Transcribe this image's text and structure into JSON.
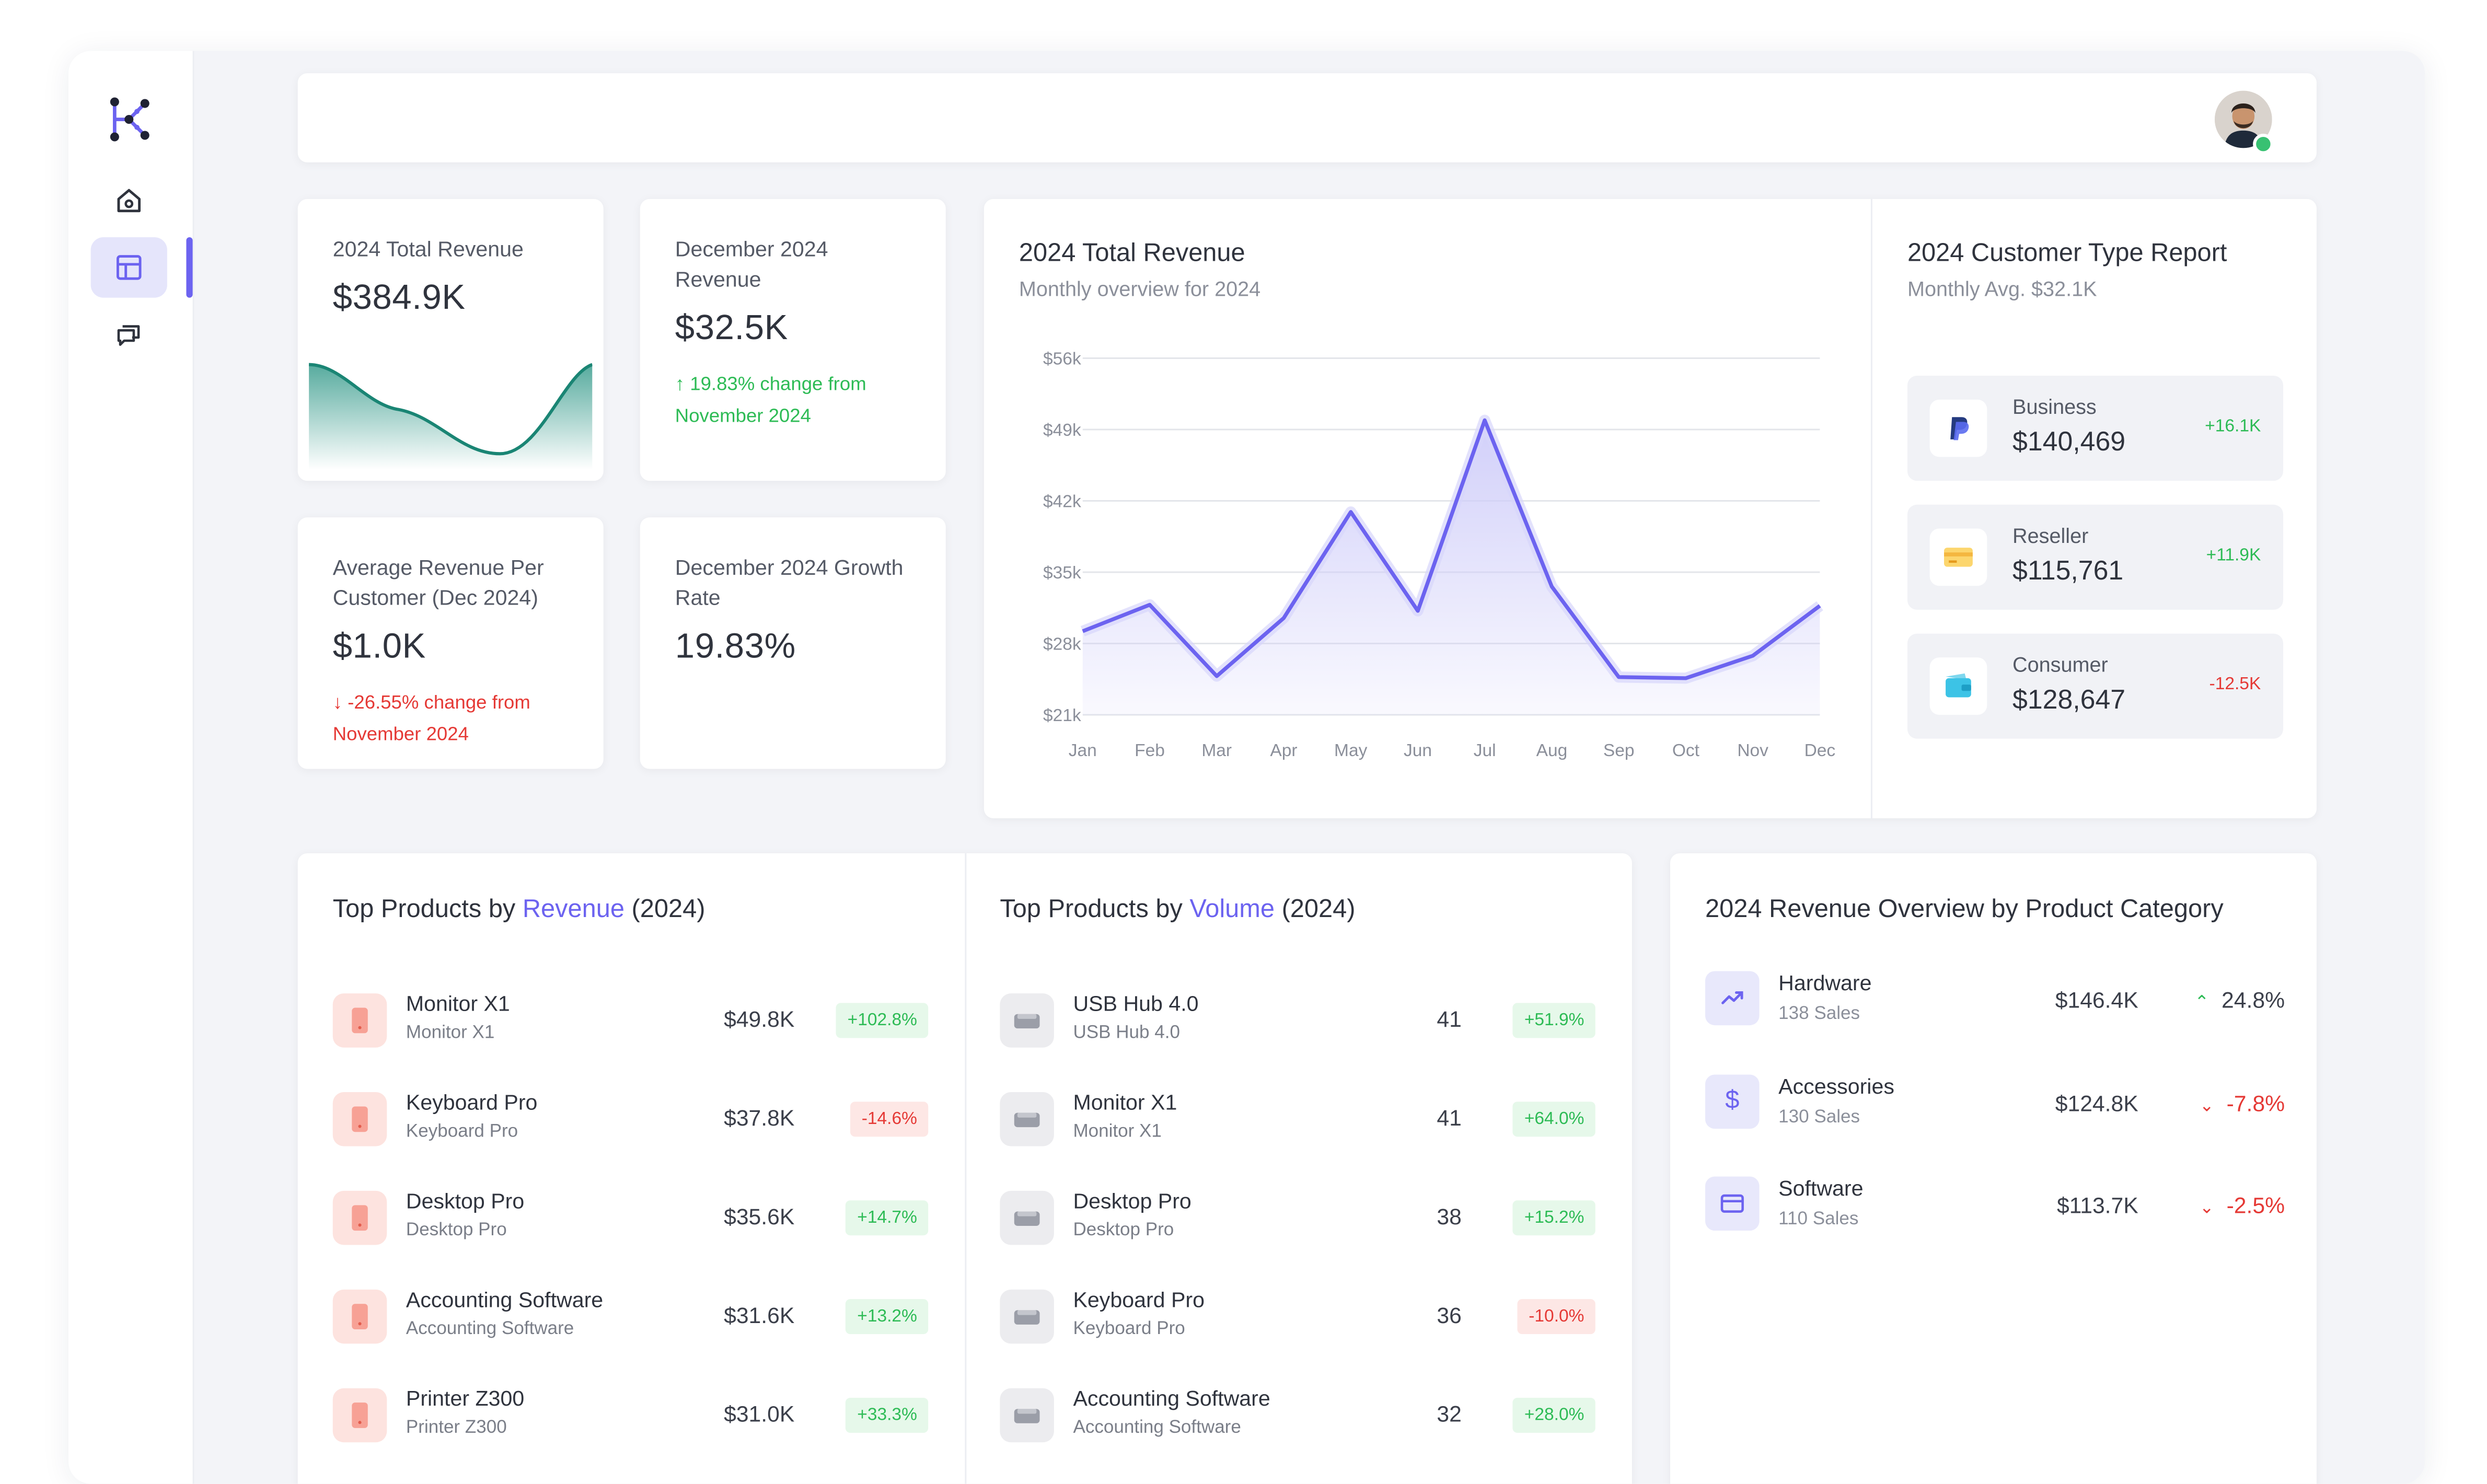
{
  "topbar": {
    "avatar_alt": "User avatar"
  },
  "kpis": [
    {
      "label": "2024 Total Revenue",
      "value": "$384.9K"
    },
    {
      "label": "December 2024 Revenue",
      "value": "$32.5K",
      "change": "19.83% change from November 2024"
    },
    {
      "label": "Average Revenue Per Customer (Dec 2024)",
      "value": "$1.0K",
      "change": "-26.55% change from November 2024"
    },
    {
      "label": "December 2024 Growth Rate",
      "value": "19.83%"
    }
  ],
  "revenue_chart": {
    "title": "2024 Total Revenue",
    "subtitle": "Monthly overview for 2024"
  },
  "chart_data": {
    "type": "area",
    "title": "2024 Total Revenue",
    "subtitle": "Monthly overview for 2024",
    "categories": [
      "Jan",
      "Feb",
      "Mar",
      "Apr",
      "May",
      "Jun",
      "Jul",
      "Aug",
      "Sep",
      "Oct",
      "Nov",
      "Dec"
    ],
    "values": [
      29.2,
      31.8,
      24.8,
      30.5,
      40.9,
      31.2,
      49.9,
      33.6,
      24.7,
      24.6,
      26.8,
      31.7
    ],
    "y_ticks": [
      "$56k",
      "$49k",
      "$42k",
      "$35k",
      "$28k",
      "$21k"
    ],
    "ylim": [
      21,
      56
    ],
    "grid": true,
    "colors": {
      "line": "#6c63f0",
      "fill": "#cfcdf9"
    }
  },
  "customer_report": {
    "title": "2024 Customer Type Report",
    "subtitle": "Monthly Avg. $32.1K",
    "items": [
      {
        "name": "Business",
        "value": "$140,469",
        "change": "+16.1K",
        "icon": "paypal-icon"
      },
      {
        "name": "Reseller",
        "value": "$115,761",
        "change": "+11.9K",
        "icon": "card-icon"
      },
      {
        "name": "Consumer",
        "value": "$128,647",
        "change": "-12.5K",
        "icon": "wallet-icon"
      }
    ]
  },
  "top_revenue": {
    "title_prefix": "Top Products by ",
    "title_highlight": "Revenue",
    "title_suffix": " (2024)",
    "rows": [
      {
        "name": "Monitor X1",
        "sub": "Monitor X1",
        "value": "$49.8K",
        "change": "+102.8%"
      },
      {
        "name": "Keyboard Pro",
        "sub": "Keyboard Pro",
        "value": "$37.8K",
        "change": "-14.6%"
      },
      {
        "name": "Desktop Pro",
        "sub": "Desktop Pro",
        "value": "$35.6K",
        "change": "+14.7%"
      },
      {
        "name": "Accounting Software",
        "sub": "Accounting Software",
        "value": "$31.6K",
        "change": "+13.2%"
      },
      {
        "name": "Printer Z300",
        "sub": "Printer Z300",
        "value": "$31.0K",
        "change": "+33.3%"
      }
    ]
  },
  "top_volume": {
    "title_prefix": "Top Products by ",
    "title_highlight": "Volume",
    "title_suffix": " (2024)",
    "rows": [
      {
        "name": "USB Hub 4.0",
        "sub": "USB Hub 4.0",
        "value": "41",
        "change": "+51.9%"
      },
      {
        "name": "Monitor X1",
        "sub": "Monitor X1",
        "value": "41",
        "change": "+64.0%"
      },
      {
        "name": "Desktop Pro",
        "sub": "Desktop Pro",
        "value": "38",
        "change": "+15.2%"
      },
      {
        "name": "Keyboard Pro",
        "sub": "Keyboard Pro",
        "value": "36",
        "change": "-10.0%"
      },
      {
        "name": "Accounting Software",
        "sub": "Accounting Software",
        "value": "32",
        "change": "+28.0%"
      }
    ]
  },
  "categories": {
    "title": "2024 Revenue Overview by Product Category",
    "rows": [
      {
        "name": "Hardware",
        "sales": "138 Sales",
        "value": "$146.4K",
        "change": "24.8%",
        "trend": "up"
      },
      {
        "name": "Accessories",
        "sales": "130 Sales",
        "value": "$124.8K",
        "change": "-7.8%",
        "trend": "down"
      },
      {
        "name": "Software",
        "sales": "110 Sales",
        "value": "$113.7K",
        "change": "-2.5%",
        "trend": "down"
      }
    ]
  },
  "colors": {
    "accent": "#6c63f0",
    "positive": "#2dbb55",
    "negative": "#e53935",
    "background": "#f3f4f8"
  }
}
